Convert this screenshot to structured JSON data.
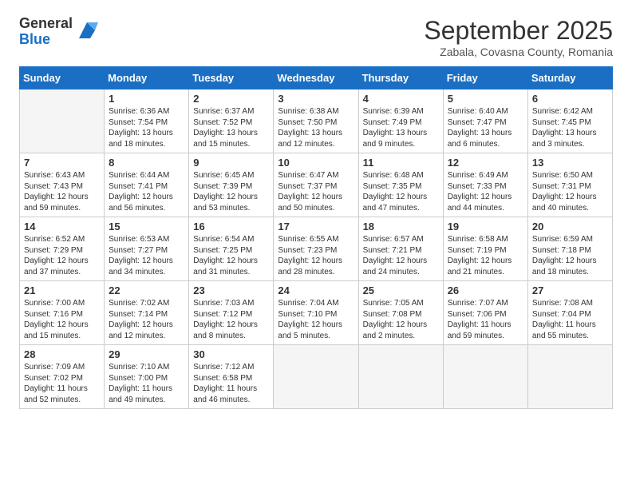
{
  "header": {
    "logo_general": "General",
    "logo_blue": "Blue",
    "month_title": "September 2025",
    "location": "Zabala, Covasna County, Romania"
  },
  "days_of_week": [
    "Sunday",
    "Monday",
    "Tuesday",
    "Wednesday",
    "Thursday",
    "Friday",
    "Saturday"
  ],
  "weeks": [
    [
      {
        "day": "",
        "info": ""
      },
      {
        "day": "1",
        "info": "Sunrise: 6:36 AM\nSunset: 7:54 PM\nDaylight: 13 hours\nand 18 minutes."
      },
      {
        "day": "2",
        "info": "Sunrise: 6:37 AM\nSunset: 7:52 PM\nDaylight: 13 hours\nand 15 minutes."
      },
      {
        "day": "3",
        "info": "Sunrise: 6:38 AM\nSunset: 7:50 PM\nDaylight: 13 hours\nand 12 minutes."
      },
      {
        "day": "4",
        "info": "Sunrise: 6:39 AM\nSunset: 7:49 PM\nDaylight: 13 hours\nand 9 minutes."
      },
      {
        "day": "5",
        "info": "Sunrise: 6:40 AM\nSunset: 7:47 PM\nDaylight: 13 hours\nand 6 minutes."
      },
      {
        "day": "6",
        "info": "Sunrise: 6:42 AM\nSunset: 7:45 PM\nDaylight: 13 hours\nand 3 minutes."
      }
    ],
    [
      {
        "day": "7",
        "info": "Sunrise: 6:43 AM\nSunset: 7:43 PM\nDaylight: 12 hours\nand 59 minutes."
      },
      {
        "day": "8",
        "info": "Sunrise: 6:44 AM\nSunset: 7:41 PM\nDaylight: 12 hours\nand 56 minutes."
      },
      {
        "day": "9",
        "info": "Sunrise: 6:45 AM\nSunset: 7:39 PM\nDaylight: 12 hours\nand 53 minutes."
      },
      {
        "day": "10",
        "info": "Sunrise: 6:47 AM\nSunset: 7:37 PM\nDaylight: 12 hours\nand 50 minutes."
      },
      {
        "day": "11",
        "info": "Sunrise: 6:48 AM\nSunset: 7:35 PM\nDaylight: 12 hours\nand 47 minutes."
      },
      {
        "day": "12",
        "info": "Sunrise: 6:49 AM\nSunset: 7:33 PM\nDaylight: 12 hours\nand 44 minutes."
      },
      {
        "day": "13",
        "info": "Sunrise: 6:50 AM\nSunset: 7:31 PM\nDaylight: 12 hours\nand 40 minutes."
      }
    ],
    [
      {
        "day": "14",
        "info": "Sunrise: 6:52 AM\nSunset: 7:29 PM\nDaylight: 12 hours\nand 37 minutes."
      },
      {
        "day": "15",
        "info": "Sunrise: 6:53 AM\nSunset: 7:27 PM\nDaylight: 12 hours\nand 34 minutes."
      },
      {
        "day": "16",
        "info": "Sunrise: 6:54 AM\nSunset: 7:25 PM\nDaylight: 12 hours\nand 31 minutes."
      },
      {
        "day": "17",
        "info": "Sunrise: 6:55 AM\nSunset: 7:23 PM\nDaylight: 12 hours\nand 28 minutes."
      },
      {
        "day": "18",
        "info": "Sunrise: 6:57 AM\nSunset: 7:21 PM\nDaylight: 12 hours\nand 24 minutes."
      },
      {
        "day": "19",
        "info": "Sunrise: 6:58 AM\nSunset: 7:19 PM\nDaylight: 12 hours\nand 21 minutes."
      },
      {
        "day": "20",
        "info": "Sunrise: 6:59 AM\nSunset: 7:18 PM\nDaylight: 12 hours\nand 18 minutes."
      }
    ],
    [
      {
        "day": "21",
        "info": "Sunrise: 7:00 AM\nSunset: 7:16 PM\nDaylight: 12 hours\nand 15 minutes."
      },
      {
        "day": "22",
        "info": "Sunrise: 7:02 AM\nSunset: 7:14 PM\nDaylight: 12 hours\nand 12 minutes."
      },
      {
        "day": "23",
        "info": "Sunrise: 7:03 AM\nSunset: 7:12 PM\nDaylight: 12 hours\nand 8 minutes."
      },
      {
        "day": "24",
        "info": "Sunrise: 7:04 AM\nSunset: 7:10 PM\nDaylight: 12 hours\nand 5 minutes."
      },
      {
        "day": "25",
        "info": "Sunrise: 7:05 AM\nSunset: 7:08 PM\nDaylight: 12 hours\nand 2 minutes."
      },
      {
        "day": "26",
        "info": "Sunrise: 7:07 AM\nSunset: 7:06 PM\nDaylight: 11 hours\nand 59 minutes."
      },
      {
        "day": "27",
        "info": "Sunrise: 7:08 AM\nSunset: 7:04 PM\nDaylight: 11 hours\nand 55 minutes."
      }
    ],
    [
      {
        "day": "28",
        "info": "Sunrise: 7:09 AM\nSunset: 7:02 PM\nDaylight: 11 hours\nand 52 minutes."
      },
      {
        "day": "29",
        "info": "Sunrise: 7:10 AM\nSunset: 7:00 PM\nDaylight: 11 hours\nand 49 minutes."
      },
      {
        "day": "30",
        "info": "Sunrise: 7:12 AM\nSunset: 6:58 PM\nDaylight: 11 hours\nand 46 minutes."
      },
      {
        "day": "",
        "info": ""
      },
      {
        "day": "",
        "info": ""
      },
      {
        "day": "",
        "info": ""
      },
      {
        "day": "",
        "info": ""
      }
    ]
  ]
}
